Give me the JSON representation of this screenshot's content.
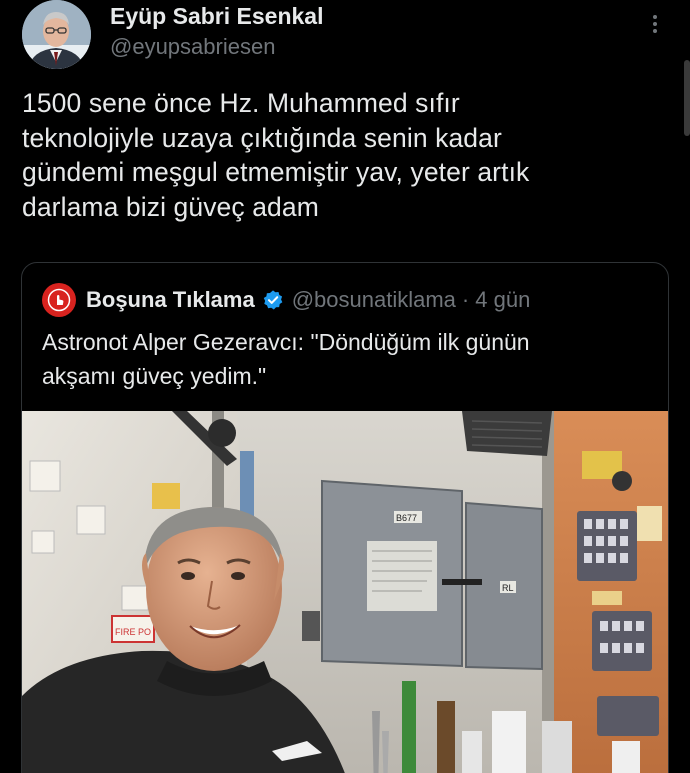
{
  "author": {
    "name": "Eyüp Sabri Esenkal",
    "handle": "@eyupsabriesen"
  },
  "icons": {
    "avatar": "person-portrait",
    "more": "more-vertical-icon",
    "quote_avatar": "hand-pointer-logo",
    "verified": "verified-badge-icon"
  },
  "tweet": {
    "text_lines": [
      "1500 sene önce Hz. Muhammed sıfır",
      "teknolojiyle uzaya çıktığında senin kadar",
      "gündemi meşgul etmemiştir yav, yeter artık",
      "darlama bizi güveç adam"
    ]
  },
  "quote": {
    "name": "Boşuna Tıklama",
    "handle": "@bosunatiklama",
    "separator": "·",
    "time": "4 gün",
    "text_lines": [
      "Astronot Alper Gezeravcı: \"Döndüğüm ilk günün",
      "akşamı güveç yedim.\""
    ],
    "photo_labels": {
      "panel_left": "B677",
      "panel_right": "RL",
      "fire": "FIRE PO"
    }
  },
  "colors": {
    "background": "#000000",
    "text": "#e7e9ea",
    "muted": "#71767b",
    "border": "#2f3336",
    "verified": "#1d9bf0",
    "brand_red": "#d8231f"
  }
}
